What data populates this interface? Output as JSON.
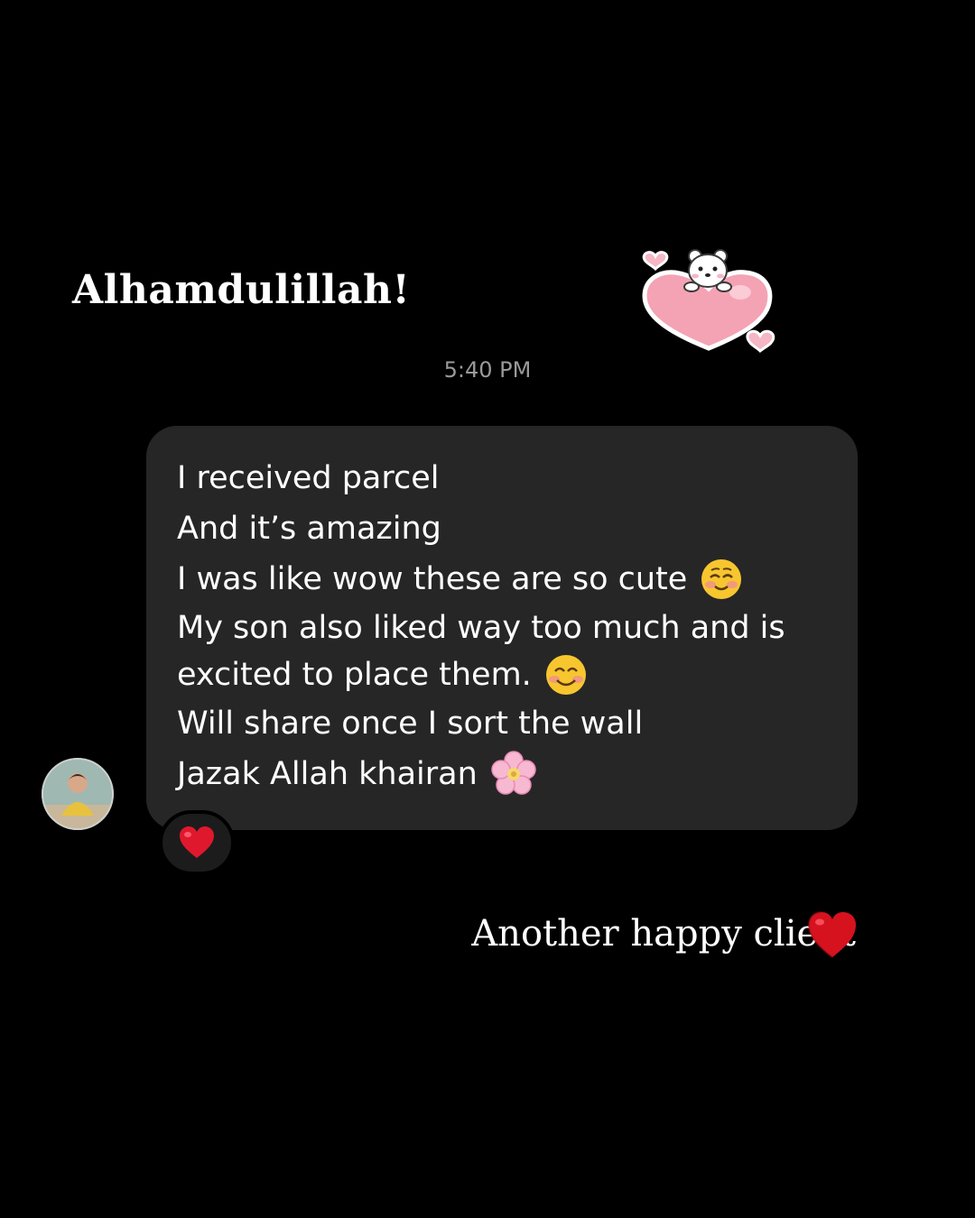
{
  "headline": "Alhamdulillah!",
  "message": {
    "timestamp": "5:40 PM",
    "lines": [
      "I received parcel",
      "And it’s amazing",
      "I was like wow these are so cute",
      "My son also liked way too much and is",
      "excited to place them.",
      "Will share once I sort the wall",
      "Jazak Allah khairan"
    ],
    "reaction": "heart-emoji"
  },
  "caption": "Another happy client",
  "colors": {
    "background": "#000000",
    "bubble": "#262626",
    "timestamp": "#9a9a9a",
    "heart_red": "#e0182d",
    "sticker_pink": "#f4a3b4"
  },
  "icons": {
    "sticker": "bear-on-heart-sticker",
    "line3_emoji": "smiling-blush-emoji",
    "line5_emoji": "smiling-face-emoji",
    "line7_emoji": "pink-flower-emoji",
    "caption_emoji": "red-heart-emoji"
  }
}
